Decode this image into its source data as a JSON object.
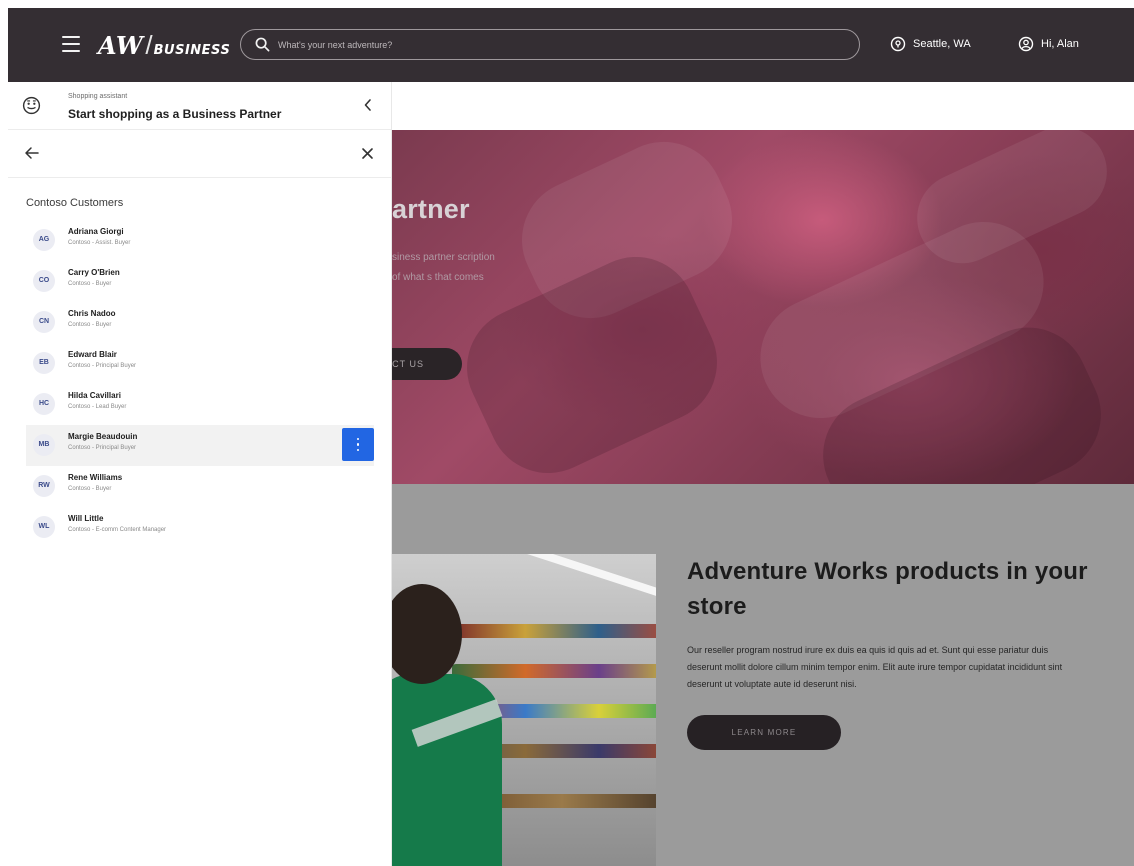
{
  "header": {
    "logo_main": "AW",
    "logo_sub": "BUSINESS",
    "search_placeholder": "What's your next adventure?",
    "location": "Seattle, WA",
    "greeting": "Hi, Alan"
  },
  "panel": {
    "assistant_subtitle": "Shopping assistant",
    "assistant_title": "Start shopping as a Business Partner",
    "section_title": "Contoso Customers",
    "customers": [
      {
        "initials": "AG",
        "name": "Adriana Giorgi",
        "role": "Contoso - Assist. Buyer"
      },
      {
        "initials": "CO",
        "name": "Carry O'Brien",
        "role": "Contoso - Buyer"
      },
      {
        "initials": "CN",
        "name": "Chris Nadoo",
        "role": "Contoso - Buyer"
      },
      {
        "initials": "EB",
        "name": "Edward Blair",
        "role": "Contoso - Principal Buyer"
      },
      {
        "initials": "HC",
        "name": "Hilda Cavillari",
        "role": "Contoso - Lead Buyer"
      },
      {
        "initials": "MB",
        "name": "Margie Beaudouin",
        "role": "Contoso - Principal Buyer"
      },
      {
        "initials": "RW",
        "name": "Rene Williams",
        "role": "Contoso - Buyer"
      },
      {
        "initials": "WL",
        "name": "Will Little",
        "role": "Contoso - E-comm Content Manager"
      }
    ],
    "selected_customer": "Margie Beaudouin"
  },
  "hero": {
    "title_fragment": "artner",
    "text_fragment": "siness partner scription of what s that comes",
    "button_fragment": "CT US"
  },
  "promo": {
    "title": "Adventure Works products in your store",
    "body": "Our reseller program nostrud irure ex duis ea quis id quis ad et. Sunt qui esse pariatur duis deserunt mollit dolore cillum minim tempor enim. Elit aute irure tempor cupidatat incididunt sint deserunt ut voluptate aute id deserunt nisi.",
    "button": "LEARN MORE"
  },
  "colors": {
    "header_bg": "#342e33",
    "accent_blue": "#2266e3",
    "overlay_gray": "#9b9b9b"
  },
  "icons": {
    "menu": "hamburger-icon",
    "search": "search-icon",
    "location": "location-pin-icon",
    "user": "user-circle-icon",
    "assistant": "assistant-face-icon",
    "collapse": "chevron-left-icon",
    "back": "arrow-left-icon",
    "close": "close-icon",
    "more": "more-vertical-icon"
  }
}
